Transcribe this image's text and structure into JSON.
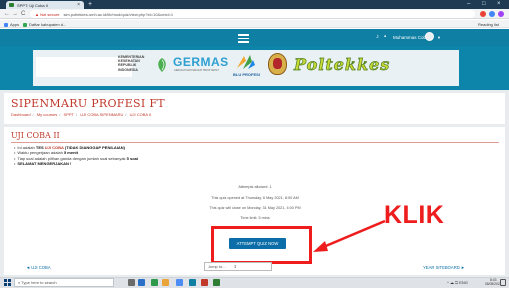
{
  "browser": {
    "tab_title": "SPPT: Uji Coba II",
    "tab_close": "×",
    "new_tab": "+",
    "window_controls": [
      "–",
      "□",
      "×"
    ],
    "nav_icons": {
      "back": "←",
      "forward": "→",
      "reload": "C"
    },
    "address": {
      "security": "▲ Not secure",
      "url": "sim.poltekkes-smh.ac.id/lib/mod/quiz/view.php?id=10&cmid=1"
    },
    "bookmarks": [
      {
        "label": "Apps",
        "icon": "apps-grid-icon",
        "color": "#4285f4"
      },
      {
        "label": "Daftar kabupaten d...",
        "icon": "bookmark-icon",
        "color": "#34a853"
      }
    ],
    "reading_list": "Reading list",
    "extension_colors": [
      "#ea4335",
      "#4285f4",
      "#a142f4"
    ]
  },
  "site": {
    "user": {
      "name": "Muhammas Coba"
    },
    "banner": {
      "ministry": [
        "KEMENTERIAN",
        "KESEHATAN",
        "REPUBLIK",
        "INDONESIA"
      ],
      "germas": "GERMAS",
      "germas_sub": "GERAKAN MASYARAKAT HIDUP SEHAT",
      "bp": "BLU PROFESI",
      "poltekkes": "Poltekkes"
    }
  },
  "page": {
    "course_title": "SIPENMARU PROFESI FT",
    "breadcrumbs": [
      "Dashboard",
      "My courses",
      "SPPT",
      "UJI COBA SIPENMARU",
      "UJI COBA II"
    ],
    "quiz_title": "UJI COBA II",
    "bullets": [
      {
        "pre": "Ini adalah ",
        "strong": "TES",
        "red": " UJI COBA",
        "post": " (TIDAK DIANGGAP PENILAIAN)"
      },
      {
        "pre": "Waktu pengerjaan adalah ",
        "strong": "5 menit",
        "red": "",
        "post": ""
      },
      {
        "pre": "Tiap soal adalah pilihan ganda dengan jumlah soal sebanyak ",
        "strong": "5 soal",
        "red": "",
        "post": ""
      },
      {
        "pre": "",
        "strong": "SELAMAT MENGERJAKAN !",
        "red": "",
        "post": ""
      }
    ],
    "attempts_allowed": "Attempts allowed: 1",
    "opened": "This quiz opened at Thursday, 6 May 2021, 8:00 AM",
    "closes": "This quiz will close on Monday, 31 May 2021, 4:00 PM",
    "time_limit": "Time limit: 5 mins",
    "attempt_button": "ATTEMPT QUIZ NOW",
    "annotation": "KLIK",
    "prev_link": "◄ UJI COBA",
    "jump_to": "Jump to...",
    "next_link": "YEAR SITEBOARD ►"
  },
  "taskbar": {
    "search_placeholder": "Type here to search",
    "tray_icons": "^ ☁ ⏍ ENG",
    "time": "8:43",
    "date": "06/05/2021",
    "app_colors": [
      "#6b6b6b",
      "#2b6fc7",
      "#2f9a4c",
      "#e9a53a",
      "#4d8cf4",
      "#0f7fa3",
      "#c0392b",
      "#2e7d32"
    ]
  }
}
